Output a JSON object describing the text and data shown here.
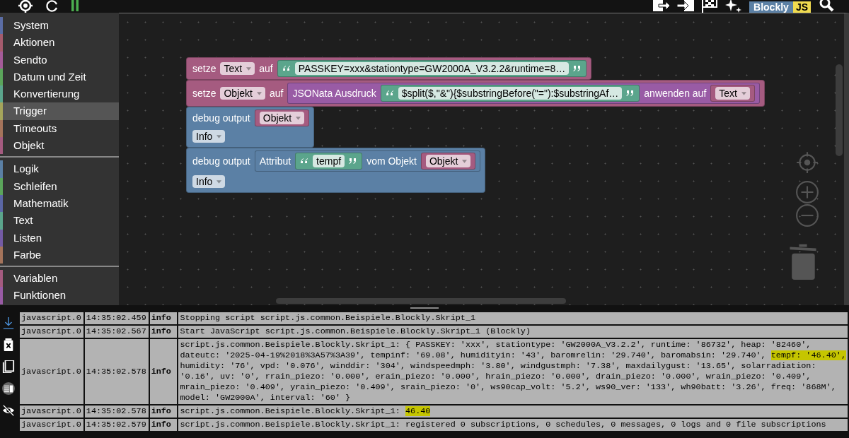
{
  "toolbar": {
    "logo": {
      "word": "Blockly",
      "badge": "JS"
    }
  },
  "sidebar": {
    "groups": [
      {
        "items": [
          {
            "label": "System",
            "color": "#5b6da5",
            "selected": false
          },
          {
            "label": "Aktionen",
            "color": "#a55b6d",
            "selected": false
          },
          {
            "label": "Sendto",
            "color": "#a55b99",
            "selected": false
          },
          {
            "label": "Datum und Zeit",
            "color": "#5ba55b",
            "selected": false
          },
          {
            "label": "Konvertierung",
            "color": "#5ba58c",
            "selected": false
          },
          {
            "label": "Trigger",
            "color": "#a5a55b",
            "selected": true
          },
          {
            "label": "Timeouts",
            "color": "#a5745b",
            "selected": false
          },
          {
            "label": "Objekt",
            "color": "#a55b80",
            "selected": false
          }
        ]
      },
      {
        "items": [
          {
            "label": "Logik",
            "color": "#5b80a5",
            "selected": false
          },
          {
            "label": "Schleifen",
            "color": "#5ba55b",
            "selected": false
          },
          {
            "label": "Mathematik",
            "color": "#5b67a5",
            "selected": false
          },
          {
            "label": "Text",
            "color": "#5ba58c",
            "selected": false
          },
          {
            "label": "Listen",
            "color": "#745ba5",
            "selected": false
          },
          {
            "label": "Farbe",
            "color": "#a5745b",
            "selected": false
          }
        ]
      },
      {
        "items": [
          {
            "label": "Variablen",
            "color": "#a55b80",
            "selected": false
          },
          {
            "label": "Funktionen",
            "color": "#995ba5",
            "selected": false
          }
        ]
      }
    ]
  },
  "workspace": {
    "statements": [
      {
        "color": "#a55b80",
        "rows": [
          [
            {
              "kind": "text",
              "text": "setze"
            },
            {
              "kind": "dropdown",
              "text": "Text"
            },
            {
              "kind": "text",
              "text": "auf"
            },
            {
              "kind": "string",
              "color": "#5ba58c",
              "text": "PASSKEY=xxx&stationtype=GW2000A_V3.2.2&runtime=8…"
            }
          ]
        ]
      },
      {
        "color": "#a55b80",
        "rows": [
          [
            {
              "kind": "text",
              "text": "setze"
            },
            {
              "kind": "dropdown",
              "text": "Objekt"
            },
            {
              "kind": "text",
              "text": "auf"
            },
            {
              "kind": "block",
              "color": "#995ba5",
              "parts": [
                {
                  "kind": "text",
                  "text": "JSONata Ausdruck"
                },
                {
                  "kind": "string",
                  "color": "#5ba58c",
                  "text": "$split($,\"&\"){$substringBefore(\"=\"):$substringAf…"
                },
                {
                  "kind": "text",
                  "text": "anwenden auf"
                },
                {
                  "kind": "block",
                  "color": "#a55b80",
                  "parts": [
                    {
                      "kind": "dropdown",
                      "text": "Text"
                    }
                  ]
                }
              ]
            }
          ]
        ]
      },
      {
        "color": "#5b80a5",
        "rows": [
          [
            {
              "kind": "text",
              "text": "debug output"
            },
            {
              "kind": "block",
              "color": "#a55b80",
              "parts": [
                {
                  "kind": "dropdown",
                  "text": "Objekt"
                }
              ]
            }
          ],
          [
            {
              "kind": "dropdown",
              "text": "Info"
            }
          ]
        ]
      },
      {
        "color": "#5b80a5",
        "rows": [
          [
            {
              "kind": "text",
              "text": "debug output"
            },
            {
              "kind": "block",
              "color": "#5b80a5",
              "parts": [
                {
                  "kind": "text",
                  "text": "Attribut"
                },
                {
                  "kind": "string",
                  "color": "#5ba58c",
                  "text": "tempf"
                },
                {
                  "kind": "text",
                  "text": "vom Objekt"
                },
                {
                  "kind": "block",
                  "color": "#a55b80",
                  "parts": [
                    {
                      "kind": "dropdown",
                      "text": "Objekt"
                    }
                  ]
                }
              ]
            }
          ],
          [
            {
              "kind": "dropdown",
              "text": "Info"
            }
          ]
        ]
      }
    ]
  },
  "log": {
    "rows": [
      {
        "source": "javascript.0",
        "time": "14:35:02.459",
        "level": "info",
        "lines": [
          [
            {
              "text": "Stopping script script.js.common.Beispiele.Blockly.Skript_1",
              "highlighted": false
            }
          ]
        ]
      },
      {
        "source": "javascript.0",
        "time": "14:35:02.567",
        "level": "info",
        "lines": [
          [
            {
              "text": "Start JavaScript script.js.common.Beispiele.Blockly.Skript_1 (Blockly)",
              "highlighted": false
            }
          ]
        ]
      },
      {
        "source": "javascript.0",
        "time": "14:35:02.578",
        "level": "info",
        "lines": [
          [
            {
              "text": "script.js.common.Beispiele.Blockly.Skript_1: { PASSKEY: 'xxx', stationtype: 'GW2000A_V3.2.2', runtime: '86732', heap: '82460',",
              "highlighted": false
            }
          ],
          [
            {
              "text": "dateutc: '2025-04-19%2018%3A57%3A39', tempinf: '69.08', humidityin: '43', baromrelin: '29.740', baromabsin: '29.740', ",
              "highlighted": false
            },
            {
              "text": "tempf: '46.40',",
              "highlighted": true
            }
          ],
          [
            {
              "text": "humidity: '76', vpd: '0.076', winddir: '304', windspeedmph: '3.80', windgustmph: '7.38', maxdailygust: '13.65', solarradiation:",
              "highlighted": false
            }
          ],
          [
            {
              "text": "'0.16', uv: '0', rrain_piezo: '0.000', erain_piezo: '0.000', hrain_piezo: '0.000', drain_piezo: '0.000', wrain_piezo: '0.409',",
              "highlighted": false
            }
          ],
          [
            {
              "text": "mrain_piezo: '0.409', yrain_piezo: '0.409', srain_piezo: '0', ws90cap_volt: '5.2', ws90_ver: '133', wh90batt: '3.26', freq: '868M',",
              "highlighted": false
            }
          ],
          [
            {
              "text": "model: 'GW2000A', interval: '60' }",
              "highlighted": false
            }
          ]
        ]
      },
      {
        "source": "javascript.0",
        "time": "14:35:02.578",
        "level": "info",
        "lines": [
          [
            {
              "text": "script.js.common.Beispiele.Blockly.Skript_1: ",
              "highlighted": false
            },
            {
              "text": "46.40",
              "highlighted": true
            }
          ]
        ]
      },
      {
        "source": "javascript.0",
        "time": "14:35:02.579",
        "level": "info",
        "lines": [
          [
            {
              "text": "script.js.common.Beispiele.Blockly.Skript_1: registered 0 subscriptions, 0 schedules, 0 messages, 0 logs and 0 file subscriptions",
              "highlighted": false
            }
          ]
        ]
      }
    ]
  }
}
